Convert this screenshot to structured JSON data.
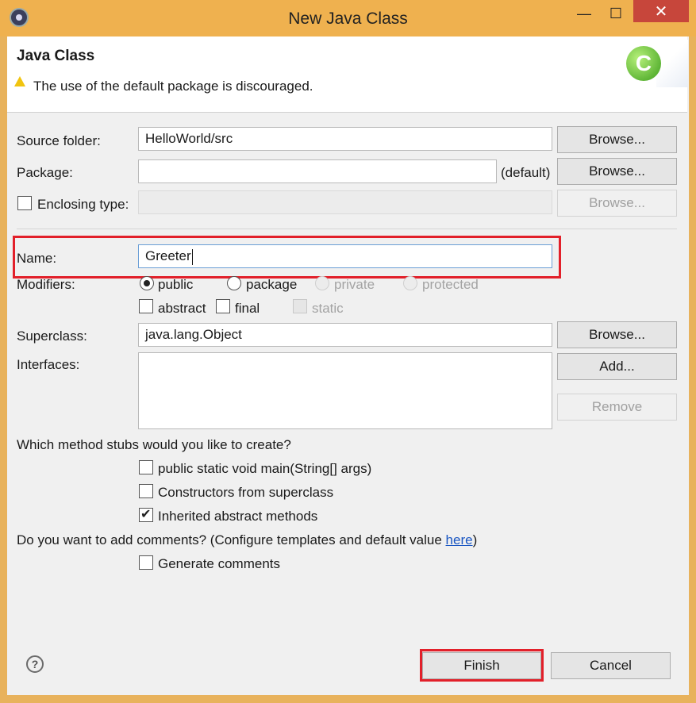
{
  "window": {
    "title": "New Java Class",
    "controls": {
      "minimize": "—",
      "maximize": "☐",
      "close": "✕"
    }
  },
  "header": {
    "title": "Java Class",
    "warning": "The use of the default package is discouraged.",
    "icon_letter": "C"
  },
  "form": {
    "source_folder": {
      "label": "Source folder:",
      "value": "HelloWorld/src",
      "browse": "Browse..."
    },
    "package": {
      "label": "Package:",
      "value": "",
      "suffix": "(default)",
      "browse": "Browse..."
    },
    "enclosing_type": {
      "label": "Enclosing type:",
      "value": "",
      "browse": "Browse..."
    },
    "name": {
      "label": "Name:",
      "value": "Greeter"
    },
    "modifiers": {
      "label": "Modifiers:",
      "visibility": [
        "public",
        "package",
        "private",
        "protected"
      ],
      "selected": "public",
      "flags": {
        "abstract": "abstract",
        "final": "final",
        "static": "static"
      }
    },
    "superclass": {
      "label": "Superclass:",
      "value": "java.lang.Object",
      "browse": "Browse..."
    },
    "interfaces": {
      "label": "Interfaces:",
      "add": "Add...",
      "remove": "Remove"
    },
    "stubs": {
      "question": "Which method stubs would you like to create?",
      "main": "public static void main(String[] args)",
      "constructors": "Constructors from superclass",
      "inherited": "Inherited abstract methods",
      "inherited_checked": true
    },
    "comments": {
      "question_prefix": "Do you want to add comments? (Configure templates and default value ",
      "link": "here",
      "question_suffix": ")",
      "generate": "Generate comments"
    }
  },
  "footer": {
    "help_icon": "?",
    "finish": "Finish",
    "cancel": "Cancel"
  },
  "colors": {
    "highlight": "#e2202a",
    "titlebar": "#efb14f",
    "close": "#c7463b"
  }
}
